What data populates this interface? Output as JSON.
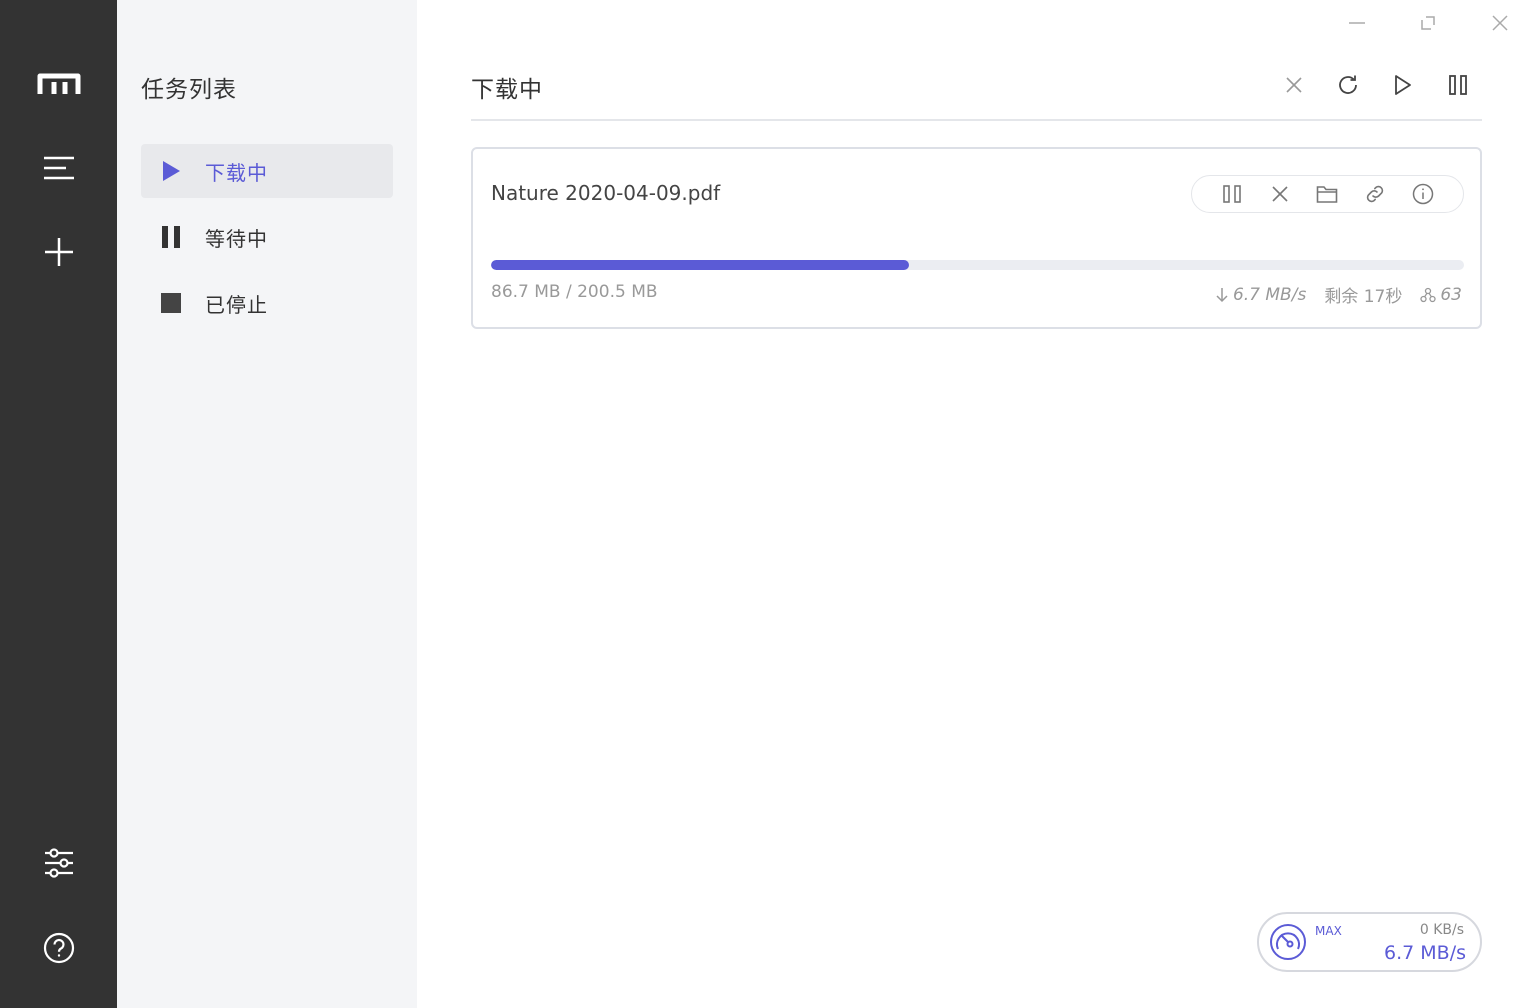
{
  "rail": {
    "icons": [
      "logo-icon",
      "menu-icon",
      "add-icon",
      "settings-icon",
      "help-icon"
    ]
  },
  "panel": {
    "title": "任务列表",
    "items": [
      {
        "label": "下载中",
        "icon": "play-icon",
        "active": true
      },
      {
        "label": "等待中",
        "icon": "pause-icon",
        "active": false
      },
      {
        "label": "已停止",
        "icon": "stop-icon",
        "active": false
      }
    ]
  },
  "main": {
    "title": "下载中",
    "toolbar": [
      "close-icon",
      "refresh-icon",
      "play-icon",
      "pause-icon"
    ]
  },
  "task": {
    "name": "Nature 2020-04-09.pdf",
    "progress": 0.43,
    "sizes": "86.7 MB / 200.5 MB",
    "speed": "6.7 MB/s",
    "remaining": "剩余 17秒",
    "connections": "63",
    "actions": [
      "pause-icon",
      "delete-icon",
      "folder-icon",
      "link-icon",
      "info-icon"
    ]
  },
  "speedometer": {
    "max_label": "MAX",
    "upload": "0 KB/s",
    "download": "6.7 MB/s"
  },
  "colors": {
    "accent": "#5b5bd6",
    "rail": "#333333",
    "panel": "#f4f5f7"
  }
}
